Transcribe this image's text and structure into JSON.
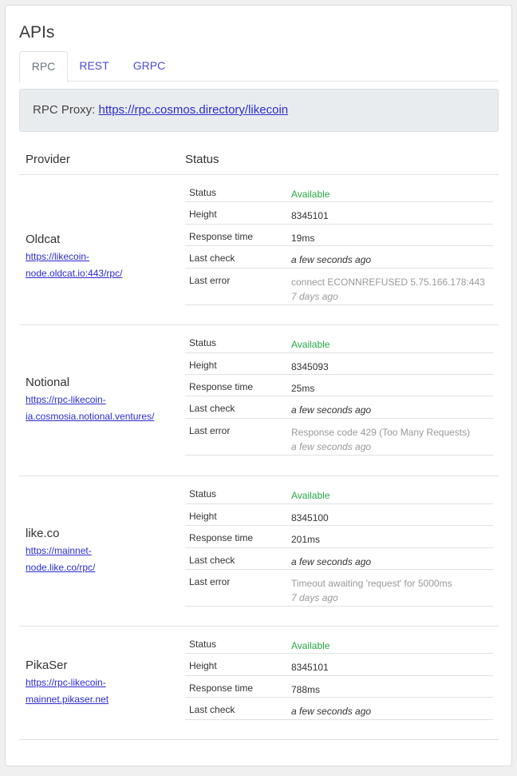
{
  "title": "APIs",
  "tabs": [
    {
      "label": "RPC",
      "active": true
    },
    {
      "label": "REST",
      "active": false
    },
    {
      "label": "GRPC",
      "active": false
    }
  ],
  "proxy": {
    "label": "RPC Proxy:",
    "url": "https://rpc.cosmos.directory/likecoin"
  },
  "table": {
    "headers": {
      "provider": "Provider",
      "status": "Status"
    },
    "field_labels": {
      "status": "Status",
      "height": "Height",
      "response_time": "Response time",
      "last_check": "Last check",
      "last_error": "Last error"
    },
    "rows": [
      {
        "provider": "Oldcat",
        "link_line1": "https://likecoin-",
        "link_line2": "node.oldcat.io:443/rpc/",
        "status": "Available",
        "height": "8345101",
        "response_time": "19ms",
        "last_check": "a few seconds ago",
        "last_error": "connect ECONNREFUSED 5.75.166.178:443",
        "last_error_ago": "7 days ago"
      },
      {
        "provider": "Notional",
        "link_line1": "https://rpc-likecoin-",
        "link_line2": "ia.cosmosia.notional.ventures/",
        "status": "Available",
        "height": "8345093",
        "response_time": "25ms",
        "last_check": "a few seconds ago",
        "last_error": "Response code 429 (Too Many Requests)",
        "last_error_ago": "a few seconds ago"
      },
      {
        "provider": "like.co",
        "link_line1": "https://mainnet-",
        "link_line2": "node.like.co/rpc/",
        "status": "Available",
        "height": "8345100",
        "response_time": "201ms",
        "last_check": "a few seconds ago",
        "last_error": "Timeout awaiting 'request' for 5000ms",
        "last_error_ago": "7 days ago"
      },
      {
        "provider": "PikaSer",
        "link_line1": "https://rpc-likecoin-",
        "link_line2": "mainnet.pikaser.net",
        "status": "Available",
        "height": "8345101",
        "response_time": "788ms",
        "last_check": "a few seconds ago"
      }
    ]
  },
  "colors": {
    "available": "#28a745",
    "link": "#2c2cd0",
    "tab_link": "#4b4bd6",
    "muted": "#9a9a9a"
  }
}
